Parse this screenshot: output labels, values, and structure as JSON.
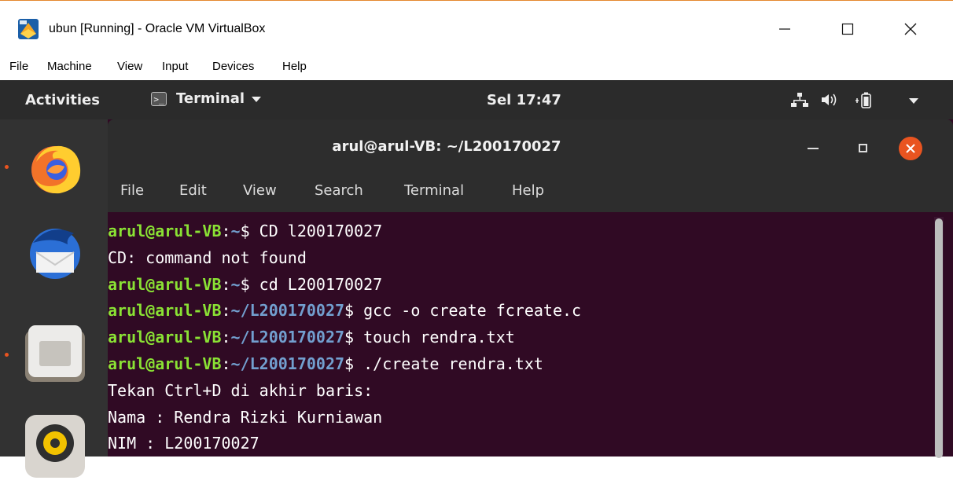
{
  "window": {
    "title": "ubun [Running] - Oracle VM VirtualBox",
    "menu": [
      "File",
      "Machine",
      "View",
      "Input",
      "Devices",
      "Help"
    ]
  },
  "topbar": {
    "activities": "Activities",
    "app_label": "Terminal",
    "app_icon_glyph": ">_",
    "clock": "Sel 17:47"
  },
  "dock": {
    "items": [
      "firefox-icon",
      "thunderbird-icon",
      "files-icon",
      "rhythmbox-icon"
    ]
  },
  "terminal": {
    "title": "arul@arul-VB: ~/L200170027",
    "menu": [
      "File",
      "Edit",
      "View",
      "Search",
      "Terminal",
      "Help"
    ],
    "lines": [
      {
        "user": "arul@arul-VB",
        "path": "~",
        "cmd": "$ CD l200170027"
      },
      {
        "text": "CD: command not found"
      },
      {
        "user": "arul@arul-VB",
        "path": "~",
        "cmd": "$ cd L200170027"
      },
      {
        "user": "arul@arul-VB",
        "path": "~/L200170027",
        "cmd": "$ gcc -o create fcreate.c"
      },
      {
        "user": "arul@arul-VB",
        "path": "~/L200170027",
        "cmd": "$ touch rendra.txt"
      },
      {
        "user": "arul@arul-VB",
        "path": "~/L200170027",
        "cmd": "$ ./create rendra.txt"
      },
      {
        "text": "Tekan Ctrl+D di akhir baris:"
      },
      {
        "text": "Nama : Rendra Rizki Kurniawan"
      },
      {
        "text": "NIM : L200170027"
      }
    ]
  },
  "colors": {
    "terminal_bg": "#300a24",
    "prompt_user": "#8ae234",
    "prompt_path": "#729fcf",
    "accent": "#e95420"
  }
}
